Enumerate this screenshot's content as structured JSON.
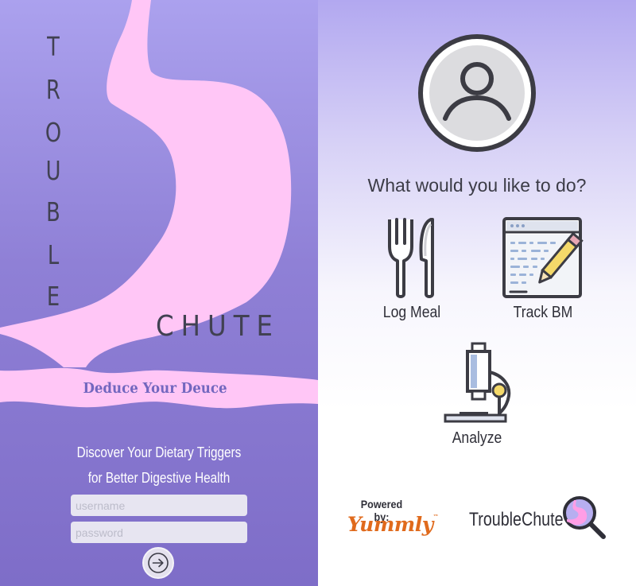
{
  "left": {
    "title_letters": [
      "T",
      "R",
      "O",
      "U",
      "B",
      "L",
      "E"
    ],
    "title_word2": "CHUTE",
    "tagline": "Deduce Your Deuce",
    "discover_line1": "Discover Your Dietary Triggers",
    "discover_line2": "for Better Digestive Health",
    "username_placeholder": "username",
    "password_placeholder": "password",
    "login_icon": "arrow-right-circle-icon"
  },
  "right": {
    "avatar_icon": "user-profile-icon",
    "question": "What would you like to do?",
    "actions": [
      {
        "label": "Log Meal",
        "icon": "fork-knife-icon"
      },
      {
        "label": "Track BM",
        "icon": "chart-pencil-icon"
      },
      {
        "label": "Analyze",
        "icon": "microscope-icon"
      }
    ],
    "powered_by": "Powered by:",
    "partner": "Yummly",
    "brand": "TroubleChute",
    "brand_icon": "stomach-magnifier-icon"
  },
  "colors": {
    "purple_bg": "#8f80d6",
    "pink_shape": "#ffc6f6",
    "dark_text": "#414152",
    "tagline": "#7367bf",
    "yummly_orange": "#e06a1c"
  }
}
